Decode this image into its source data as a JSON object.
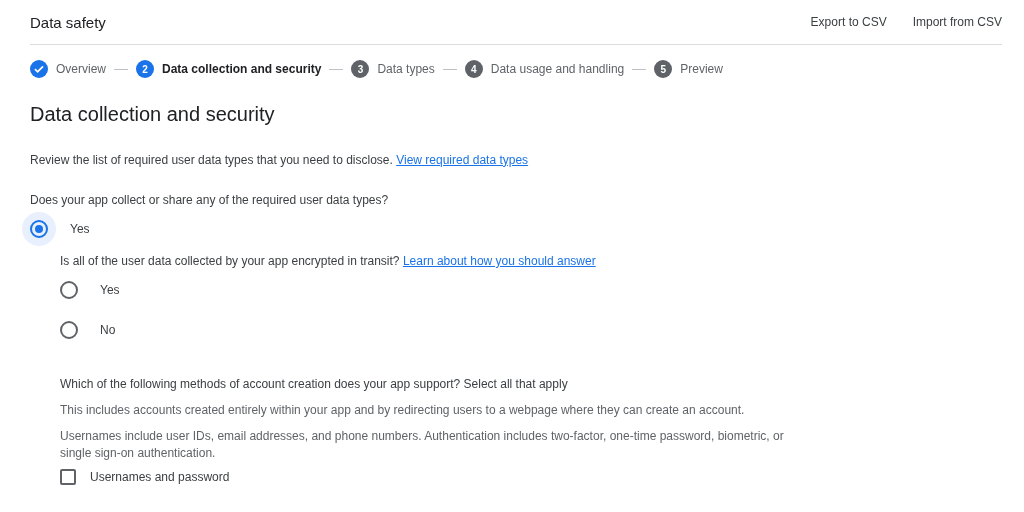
{
  "header": {
    "title": "Data safety",
    "actions": [
      "Export to CSV",
      "Import from CSV"
    ]
  },
  "steps": [
    {
      "label": "Overview",
      "done": true,
      "selected": false
    },
    {
      "number": "2",
      "label": "Data collection and security",
      "done": false,
      "selected": true
    },
    {
      "number": "3",
      "label": "Data types",
      "done": false,
      "selected": false
    },
    {
      "number": "4",
      "label": "Data usage and handling",
      "done": false,
      "selected": false
    },
    {
      "number": "5",
      "label": "Preview",
      "done": false,
      "selected": false
    }
  ],
  "heading": "Data collection and security",
  "intro": {
    "text": "Review the list of required user data types that you need to disclose.",
    "link": "View required data types"
  },
  "collect_question": {
    "text": "Does your app collect or share any of the required user data types?",
    "options": [
      {
        "label": "Yes",
        "selected": true
      }
    ]
  },
  "encryption_question": {
    "text": "Is all of the user data collected by your app encrypted in transit?",
    "link": "Learn about how you should answer",
    "options": [
      {
        "label": "Yes",
        "selected": false
      },
      {
        "label": "No",
        "selected": false
      }
    ]
  },
  "account_question": {
    "text": "Which of the following methods of account creation does your app support? Select all that apply",
    "notes": [
      "This includes accounts created entirely within your app and by redirecting users to a webpage where they can create an account.",
      "Usernames include user IDs, email addresses, and phone numbers. Authentication includes two-factor, one-time password, biometric, or single sign-on authentication."
    ],
    "options": [
      {
        "label": "Usernames and password",
        "checked": false
      }
    ]
  }
}
